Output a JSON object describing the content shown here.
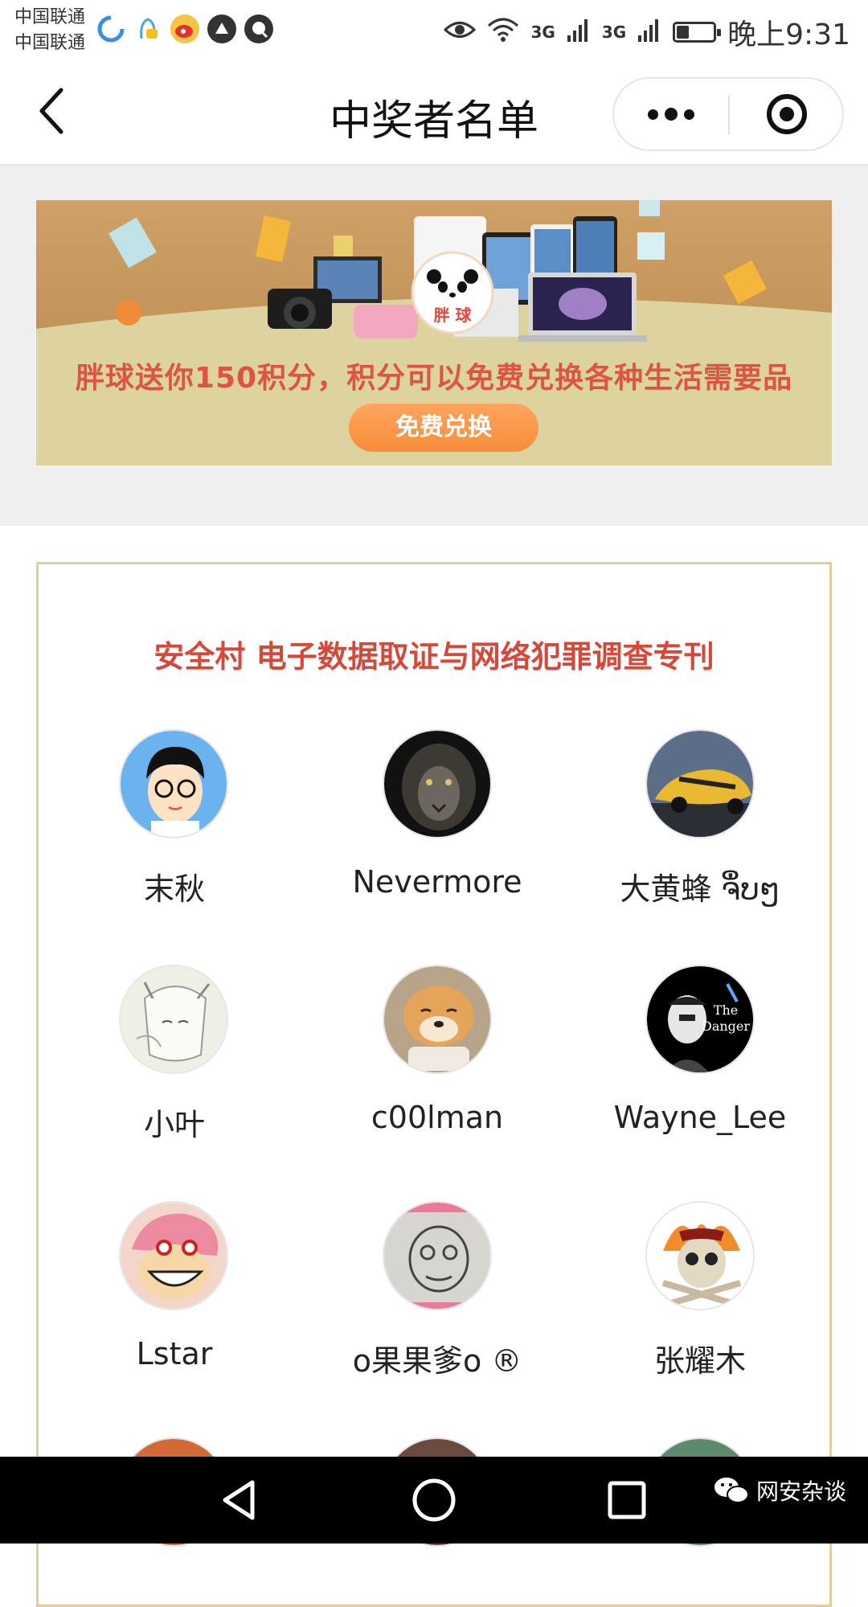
{
  "status_bar": {
    "carriers": [
      "中国联通",
      "中国联通"
    ],
    "network_1": "3G",
    "network_2": "3G",
    "battery_level": 0.3,
    "time": "晚上9:31",
    "icons": [
      "browser-icon",
      "qq-icon",
      "weibo-icon",
      "app-icon",
      "chat-icon",
      "eye-icon",
      "wifi-icon",
      "signal-icon",
      "battery-icon"
    ]
  },
  "nav": {
    "title": "中奖者名单"
  },
  "banner": {
    "brand": "胖 球",
    "text": "胖球送你150积分，积分可以免费兑换各种生活需要品",
    "button": "免费兑换"
  },
  "card": {
    "title": "安全村 电子数据取证与网络犯罪调查专刊",
    "winners": [
      {
        "name": "末秋"
      },
      {
        "name": "Nevermore"
      },
      {
        "name": "大黄蜂 ຈຶ່ບໆ"
      },
      {
        "name": "小叶"
      },
      {
        "name": "c00lman"
      },
      {
        "name": "Wayne_Lee"
      },
      {
        "name": "Lstar"
      },
      {
        "name": "o果果爹o ®"
      },
      {
        "name": "张耀木"
      }
    ]
  },
  "watermark": {
    "text": "网安杂谈"
  },
  "colors": {
    "accent_red": "#d4493a",
    "banner_bg": "#ddd39f",
    "button_orange": "#f78d3b",
    "card_border": "#e3cd9c"
  }
}
